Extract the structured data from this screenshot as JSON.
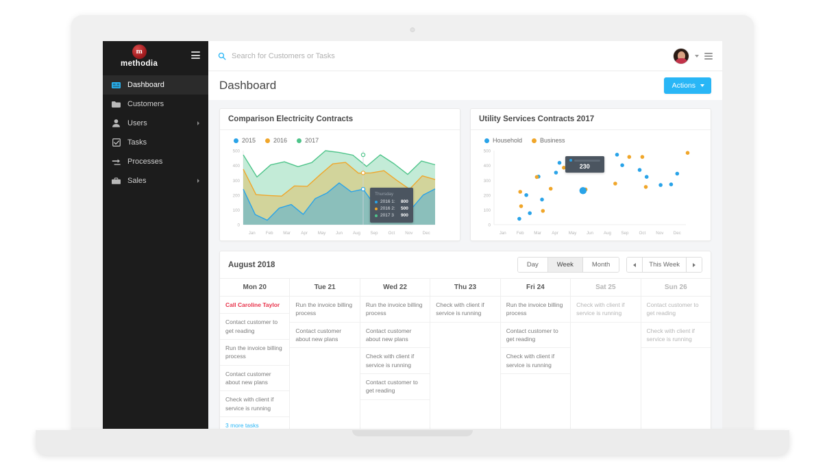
{
  "brand": {
    "mark": "m",
    "name": "methodia"
  },
  "sidebar": {
    "items": [
      {
        "label": "Dashboard",
        "icon": "dashboard-icon",
        "active": true,
        "caret": false
      },
      {
        "label": "Customers",
        "icon": "folder-icon",
        "active": false,
        "caret": false
      },
      {
        "label": "Users",
        "icon": "user-icon",
        "active": false,
        "caret": true
      },
      {
        "label": "Tasks",
        "icon": "checkbox-icon",
        "active": false,
        "caret": false
      },
      {
        "label": "Processes",
        "icon": "process-icon",
        "active": false,
        "caret": false
      },
      {
        "label": "Sales",
        "icon": "briefcase-icon",
        "active": false,
        "caret": true
      }
    ]
  },
  "topbar": {
    "search_placeholder": "Search for Customers or Tasks",
    "search_value": "",
    "search_icon": "search-icon",
    "avatar": "user-avatar",
    "menu_icon": "menu-icon"
  },
  "page": {
    "title": "Dashboard",
    "actions_label": "Actions"
  },
  "colors": {
    "accent": "#29b6f6",
    "series_2015": "#29a3e8",
    "series_2016": "#f0a62a",
    "series_2017": "#4ec48a",
    "alert": "#e8324a",
    "sidebar_bg": "#1c1c1c",
    "logo_red": "#a31d20"
  },
  "chart_data": [
    {
      "type": "area",
      "title": "Comparison Electricity Contracts",
      "xlabel": "",
      "ylabel": "",
      "ylim": [
        0,
        500
      ],
      "yticks": [
        0,
        100,
        200,
        300,
        400,
        500
      ],
      "grid": false,
      "legend_position": "top-left",
      "categories": [
        "Jan",
        "Feb",
        "Mar",
        "Apr",
        "May",
        "Jun",
        "Aug",
        "Sep",
        "Oct",
        "Nov",
        "Dec"
      ],
      "x": [
        "Jan",
        "",
        "Feb",
        "",
        "Mar",
        "",
        "Apr",
        "",
        "May",
        "",
        "Jun",
        "",
        "Aug",
        "",
        "Sep",
        "",
        "Oct",
        "",
        "Nov",
        "",
        "Dec",
        ""
      ],
      "series": [
        {
          "name": "2015",
          "color": "#29a3e8",
          "values": [
            240,
            68,
            30,
            112,
            136,
            70,
            176,
            215,
            282,
            222,
            240,
            128,
            227,
            172,
            105,
            200,
            242
          ]
        },
        {
          "name": "2016",
          "color": "#f0a62a",
          "values": [
            375,
            203,
            197,
            193,
            262,
            259,
            337,
            411,
            421,
            348,
            350,
            365,
            300,
            240,
            330,
            305
          ]
        },
        {
          "name": "2017",
          "color": "#4ec48a",
          "values": [
            472,
            322,
            404,
            425,
            392,
            420,
            500,
            488,
            470,
            394,
            472,
            412,
            340,
            430,
            405
          ]
        }
      ],
      "tooltip": {
        "title": "Thursday",
        "rows": [
          {
            "label": "2016 1:",
            "value": "800",
            "color": "#29a3e8"
          },
          {
            "label": "2016 2:",
            "value": "500",
            "color": "#f0a62a"
          },
          {
            "label": "2017 3",
            "value": "900",
            "color": "#4ec48a"
          }
        ]
      }
    },
    {
      "type": "scatter",
      "title": "Utility Services Contracts 2017",
      "xlabel": "",
      "ylabel": "",
      "ylim": [
        0,
        500
      ],
      "yticks": [
        0,
        100,
        200,
        300,
        400,
        500
      ],
      "grid": false,
      "legend_position": "top-left",
      "categories": [
        "Jan",
        "Feb",
        "Mar",
        "Apr",
        "May",
        "Jun",
        "Aug",
        "Sep",
        "Oct",
        "Nov",
        "Dec"
      ],
      "series": [
        {
          "name": "Household",
          "color": "#29a3e8",
          "points": [
            [
              0.95,
              40
            ],
            [
              1.35,
              200
            ],
            [
              1.55,
              78
            ],
            [
              2.05,
              325
            ],
            [
              2.25,
              170
            ],
            [
              3.25,
              418
            ],
            [
              3.05,
              352
            ],
            [
              4.35,
              432
            ],
            [
              4.6,
              230
            ],
            [
              6.55,
              473
            ],
            [
              6.85,
              402
            ],
            [
              7.85,
              370
            ],
            [
              8.25,
              323
            ],
            [
              9.05,
              268
            ],
            [
              9.65,
              272
            ],
            [
              10.0,
              345
            ],
            [
              10.85,
              325
            ]
          ]
        },
        {
          "name": "Business",
          "color": "#f0a62a",
          "points": [
            [
              1.0,
              222
            ],
            [
              1.05,
              125
            ],
            [
              1.95,
              322
            ],
            [
              2.3,
              93
            ],
            [
              2.75,
              243
            ],
            [
              3.5,
              385
            ],
            [
              4.75,
              238
            ],
            [
              5.6,
              382
            ],
            [
              6.45,
              278
            ],
            [
              7.25,
              458
            ],
            [
              8.0,
              458
            ],
            [
              8.2,
              255
            ],
            [
              10.6,
              485
            ],
            [
              10.85,
              225
            ]
          ]
        }
      ],
      "tooltip": {
        "label": "Household",
        "value": "230"
      }
    }
  ],
  "calendar": {
    "title": "August 2018",
    "views": [
      {
        "label": "Day",
        "active": false
      },
      {
        "label": "Week",
        "active": true
      },
      {
        "label": "Month",
        "active": false
      }
    ],
    "prev_icon": "chevron-left-icon",
    "next_icon": "chevron-right-icon",
    "range_label": "This Week",
    "columns": [
      {
        "day": "Mon 20",
        "weekend": false,
        "tasks": [
          {
            "text": "Call Caroline Taylor",
            "style": "alert"
          },
          {
            "text": "Contact customer to get reading",
            "style": "normal"
          },
          {
            "text": "Run the invoice billing process",
            "style": "normal"
          },
          {
            "text": "Contact customer about new plans",
            "style": "normal"
          },
          {
            "text": "Check with client if service is running",
            "style": "normal"
          },
          {
            "text": "3 more tasks",
            "style": "more"
          }
        ]
      },
      {
        "day": "Tue 21",
        "weekend": false,
        "tasks": [
          {
            "text": "Run the invoice billing process",
            "style": "normal"
          },
          {
            "text": "Contact customer about new plans",
            "style": "normal"
          }
        ]
      },
      {
        "day": "Wed 22",
        "weekend": false,
        "tasks": [
          {
            "text": "Run the invoice billing process",
            "style": "normal"
          },
          {
            "text": "Contact customer about new plans",
            "style": "normal"
          },
          {
            "text": "Check with client if service is running",
            "style": "normal"
          },
          {
            "text": "Contact customer to get reading",
            "style": "normal"
          }
        ]
      },
      {
        "day": "Thu 23",
        "weekend": false,
        "tasks": [
          {
            "text": "Check with client if service is running",
            "style": "normal"
          }
        ]
      },
      {
        "day": "Fri 24",
        "weekend": false,
        "tasks": [
          {
            "text": "Run the invoice billing process",
            "style": "normal"
          },
          {
            "text": "Contact customer to get reading",
            "style": "normal"
          },
          {
            "text": "Check with client if service is running",
            "style": "normal"
          }
        ]
      },
      {
        "day": "Sat 25",
        "weekend": true,
        "tasks": [
          {
            "text": "Check with client if service is running",
            "style": "normal"
          }
        ]
      },
      {
        "day": "Sun 26",
        "weekend": true,
        "tasks": [
          {
            "text": "Contact customer to get reading",
            "style": "normal"
          },
          {
            "text": "Check with client if service is running",
            "style": "normal"
          }
        ]
      }
    ]
  }
}
